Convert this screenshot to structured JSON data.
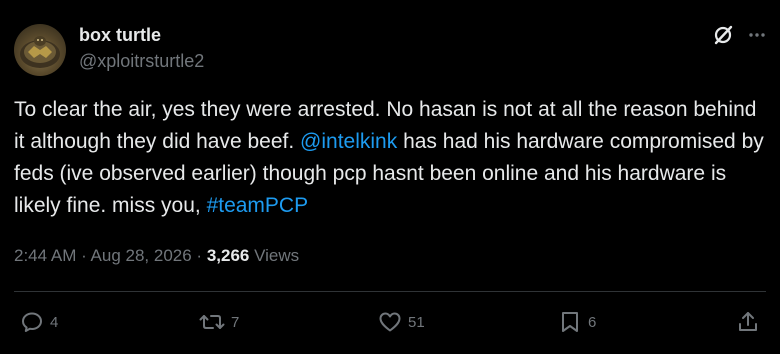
{
  "author": {
    "name": "box turtle",
    "handle": "@xploitrsturtle2",
    "avatar_icon": "turtle-avatar"
  },
  "header_actions": {
    "grok_icon": "grok-icon",
    "more_icon": "more-icon",
    "more_label": "···"
  },
  "tweet": {
    "text_part1": "To clear the air, yes they were arrested. No hasan is not at all the reason behind it although they did have beef. ",
    "mention": "@intelkink",
    "text_part2": " has had his hardware compromised by feds (ive observed earlier) though pcp hasnt been online and his hardware is likely fine. miss you, ",
    "hashtag": "#teamPCP"
  },
  "meta": {
    "time": "2:44 AM",
    "separator1": " · ",
    "date": "Aug 28, 2026",
    "separator2": " · ",
    "views_count": "3,266",
    "views_label": " Views"
  },
  "actions": {
    "reply_count": "4",
    "repost_count": "7",
    "like_count": "51",
    "bookmark_count": "6"
  },
  "colors": {
    "background": "#000000",
    "text": "#e7e9ea",
    "secondary": "#71767b",
    "link": "#1d9bf0",
    "divider": "#2f3336"
  }
}
